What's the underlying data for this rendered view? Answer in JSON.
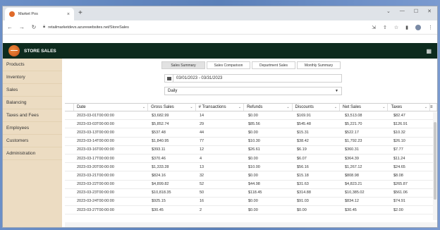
{
  "browser": {
    "tab_title": "Market Pos",
    "url": "retailmarketdevs.azurewebsites.net/StoreSales"
  },
  "app": {
    "title": "STORE SALES"
  },
  "sidebar": {
    "items": [
      {
        "label": "Products"
      },
      {
        "label": "Inventory"
      },
      {
        "label": "Sales"
      },
      {
        "label": "Balancing"
      },
      {
        "label": "Taxes and Fees"
      },
      {
        "label": "Employees"
      },
      {
        "label": "Customers"
      },
      {
        "label": "Administration"
      }
    ]
  },
  "tabs": [
    {
      "label": "Sales Summary",
      "active": true
    },
    {
      "label": "Sales Comparison",
      "active": false
    },
    {
      "label": "Department Sales",
      "active": false
    },
    {
      "label": "Monthly Summary",
      "active": false
    }
  ],
  "date_range": "03/01/2023 - 03/31/2023",
  "period_select": "Daily",
  "grid": {
    "columns": [
      "Date",
      "Gross Sales",
      "# Transactions",
      "Refunds",
      "Discounts",
      "Net Sales",
      "Taxes"
    ],
    "rows": [
      [
        "2023-03-01T00:00:00",
        "$3,682.99",
        "14",
        "$0.00",
        "$169.91",
        "$3,513.08",
        "$82.47"
      ],
      [
        "2023-03-03T00:00:00",
        "$5,852.74",
        "29",
        "$85.56",
        "$545.48",
        "$5,221.70",
        "$126.91"
      ],
      [
        "2023-03-13T00:00:00",
        "$537.48",
        "44",
        "$0.00",
        "$15.31",
        "$522.17",
        "$10.32"
      ],
      [
        "2023-03-14T00:00:00",
        "$1,840.95",
        "77",
        "$10.30",
        "$38.42",
        "$1,792.23",
        "$26.10"
      ],
      [
        "2023-03-16T00:00:00",
        "$393.11",
        "12",
        "$26.61",
        "$6.19",
        "$360.31",
        "$7.77"
      ],
      [
        "2023-03-17T00:00:00",
        "$370.46",
        "4",
        "$0.00",
        "$6.07",
        "$364.39",
        "$11.24"
      ],
      [
        "2023-03-20T00:00:00",
        "$1,333.28",
        "13",
        "$10.00",
        "$56.16",
        "$1,267.12",
        "$24.65"
      ],
      [
        "2023-03-21T00:00:00",
        "$824.16",
        "32",
        "$0.00",
        "$15.18",
        "$808.98",
        "$8.08"
      ],
      [
        "2023-03-22T00:00:00",
        "$4,899.82",
        "52",
        "$44.98",
        "$31.63",
        "$4,823.21",
        "$265.87"
      ],
      [
        "2023-03-23T00:00:00",
        "$10,818.35",
        "50",
        "$118.45",
        "$314.88",
        "$10,385.02",
        "$561.06"
      ],
      [
        "2023-03-24T00:00:00",
        "$925.15",
        "16",
        "$0.00",
        "$91.03",
        "$834.12",
        "$74.91"
      ],
      [
        "2023-03-27T00:00:00",
        "$30.45",
        "2",
        "$0.00",
        "$0.00",
        "$30.45",
        "$2.00"
      ]
    ]
  }
}
